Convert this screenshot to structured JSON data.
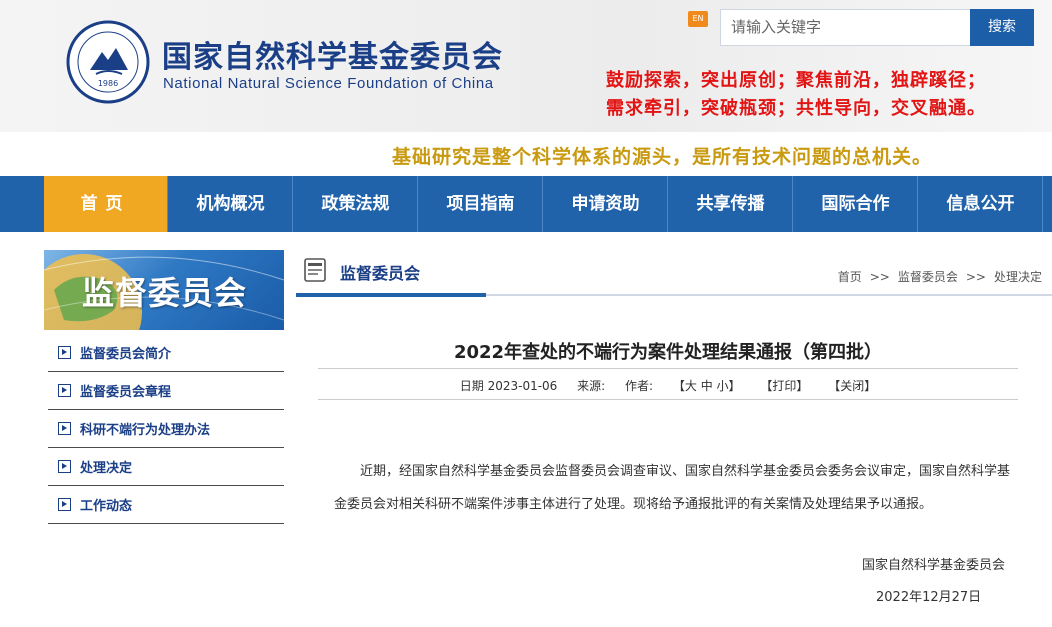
{
  "header": {
    "logo_year": "1986",
    "title_cn": "国家自然科学基金委员会",
    "title_en": "National Natural Science Foundation of China",
    "en_badge": "EN",
    "search_placeholder": "请输入关键字",
    "search_button": "搜索",
    "slogan_line1": "鼓励探索，突出原创；聚焦前沿，独辟蹊径；",
    "slogan_line2": "需求牵引，突破瓶颈；共性导向，交叉融通。",
    "tagline": "基础研究是整个科学体系的源头，是所有技术问题的总机关。"
  },
  "nav": {
    "items": [
      "首页",
      "机构概况",
      "政策法规",
      "项目指南",
      "申请资助",
      "共享传播",
      "国际合作",
      "信息公开"
    ],
    "active_index": 0
  },
  "sidebar": {
    "banner_title": "监督委员会",
    "items": [
      "监督委员会简介",
      "监督委员会章程",
      "科研不端行为处理办法",
      "处理决定",
      "工作动态"
    ]
  },
  "main": {
    "section_title": "监督委员会",
    "breadcrumb": [
      "首页",
      "监督委员会",
      "处理决定"
    ],
    "breadcrumb_sep": ">>",
    "article_title": "2022年查处的不端行为案件处理结果通报（第四批）",
    "meta": {
      "date": "日期 2023-01-06",
      "source": "来源:",
      "author": "作者:",
      "font_size": "【大 中 小】",
      "print": "【打印】",
      "close": "【关闭】"
    },
    "paragraph": "近期，经国家自然科学基金委员会监督委员会调查审议、国家自然科学基金委员会委务会议审定，国家自然科学基金委员会对相关科研不端案件涉事主体进行了处理。现将给予通报批评的有关案情及处理结果予以通报。",
    "signature": "国家自然科学基金委员会",
    "sign_date": "2022年12月27日"
  },
  "colors": {
    "brand_blue": "#1b3f87",
    "nav_blue": "#2163aa",
    "nav_active": "#f0a823",
    "slogan_red": "#e21414",
    "tagline_gold": "#c99a10"
  }
}
